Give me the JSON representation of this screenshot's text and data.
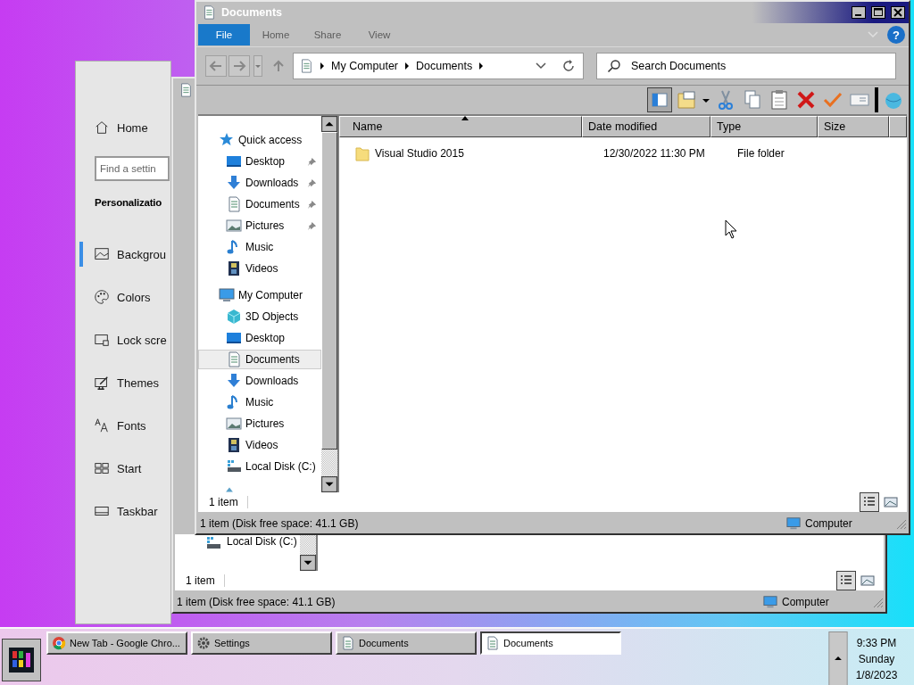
{
  "settings_window": {
    "home": "Home",
    "search": {
      "placeholder": "Find a settin"
    },
    "section": "Personalizatio",
    "items": [
      {
        "label": "Backgrou",
        "kind": "background",
        "selected": true
      },
      {
        "label": "Colors",
        "kind": "colors",
        "selected": false
      },
      {
        "label": "Lock scre",
        "kind": "lock",
        "selected": false
      },
      {
        "label": "Themes",
        "kind": "themes",
        "selected": false
      },
      {
        "label": "Fonts",
        "kind": "fonts",
        "selected": false
      },
      {
        "label": "Start",
        "kind": "start",
        "selected": false
      },
      {
        "label": "Taskbar",
        "kind": "taskbar",
        "selected": false
      }
    ]
  },
  "back_window": {
    "nav_item": {
      "label": "Local Disk (C:)",
      "kind": "disk"
    },
    "item_count": "1 item",
    "status": "1 item (Disk free space: 41.1 GB)",
    "location": "Computer"
  },
  "window": {
    "title": "Documents",
    "ribbon_tabs": [
      {
        "label": "File",
        "selected": true
      },
      {
        "label": "Home",
        "selected": false
      },
      {
        "label": "Share",
        "selected": false
      },
      {
        "label": "View",
        "selected": false
      }
    ],
    "help": "?",
    "address": {
      "breadcrumbs": [
        "My Computer",
        "Documents"
      ]
    },
    "search": {
      "placeholder": "Search Documents"
    },
    "nav": [
      {
        "label": "Quick access",
        "kind": "star",
        "selected": false,
        "children": [
          {
            "label": "Desktop",
            "kind": "desktop",
            "pinned": true,
            "selected": false
          },
          {
            "label": "Downloads",
            "kind": "downloads",
            "pinned": true,
            "selected": false
          },
          {
            "label": "Documents",
            "kind": "documents",
            "pinned": true,
            "selected": false
          },
          {
            "label": "Pictures",
            "kind": "pictures",
            "pinned": true,
            "selected": false
          },
          {
            "label": "Music",
            "kind": "music",
            "pinned": false,
            "selected": false
          },
          {
            "label": "Videos",
            "kind": "videos",
            "pinned": false,
            "selected": false
          }
        ]
      },
      {
        "label": "My Computer",
        "kind": "computer",
        "selected": false,
        "children": [
          {
            "label": "3D Objects",
            "kind": "objects",
            "pinned": false,
            "selected": false
          },
          {
            "label": "Desktop",
            "kind": "desktop",
            "pinned": false,
            "selected": false
          },
          {
            "label": "Documents",
            "kind": "documents",
            "pinned": false,
            "selected": true
          },
          {
            "label": "Downloads",
            "kind": "downloads",
            "pinned": false,
            "selected": false
          },
          {
            "label": "Music",
            "kind": "music",
            "pinned": false,
            "selected": false
          },
          {
            "label": "Pictures",
            "kind": "pictures",
            "pinned": false,
            "selected": false
          },
          {
            "label": "Videos",
            "kind": "videos",
            "pinned": false,
            "selected": false
          },
          {
            "label": "Local Disk (C:)",
            "kind": "disk",
            "pinned": false,
            "selected": false
          }
        ]
      }
    ],
    "table": {
      "columns": [
        "Name",
        "Date modified",
        "Type",
        "Size"
      ],
      "rows": [
        {
          "name": "Visual Studio 2015",
          "date_modified": "12/30/2022 11:30 PM",
          "type": "File folder",
          "selected": false
        }
      ]
    },
    "item_count": "1 item",
    "status": "1 item (Disk free space: 41.1 GB)",
    "location": "Computer"
  },
  "taskbar": {
    "tasks": [
      {
        "label": "New Tab - Google Chro...",
        "kind": "chrome",
        "selected": false
      },
      {
        "label": "Settings",
        "kind": "settings",
        "selected": false
      },
      {
        "label": "Documents",
        "kind": "documents",
        "selected": false
      },
      {
        "label": "Documents",
        "kind": "documents",
        "selected": true
      }
    ],
    "clock": {
      "time": "9:33 PM",
      "day": "Sunday",
      "date": "1/8/2023"
    }
  }
}
